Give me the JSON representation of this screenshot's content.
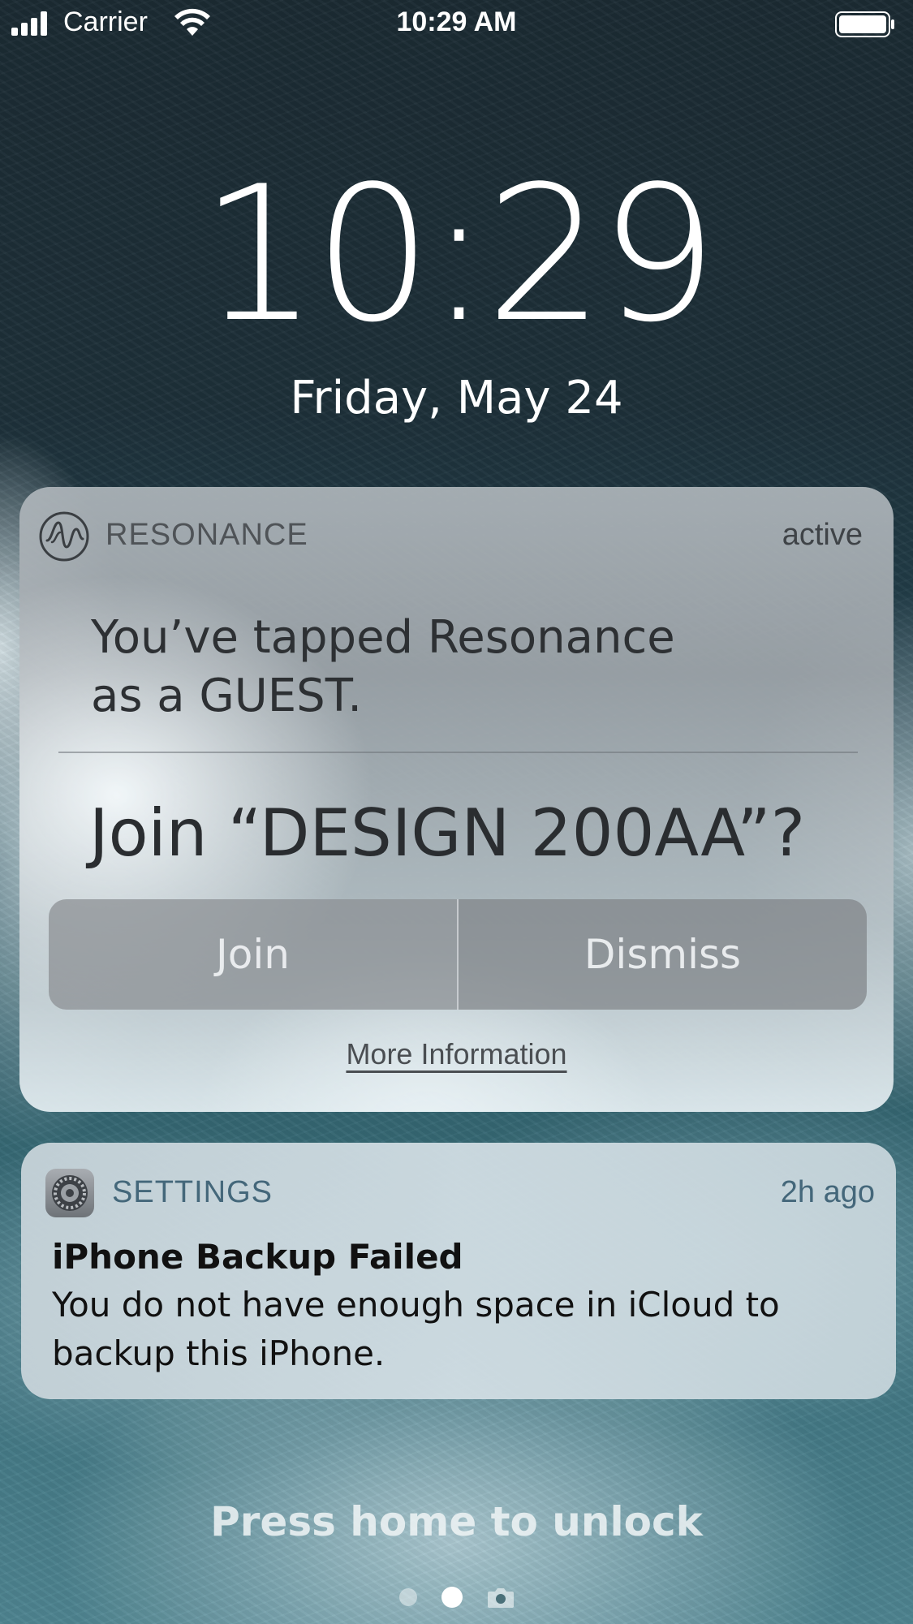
{
  "status_bar": {
    "carrier": "Carrier",
    "time": "10:29 AM"
  },
  "lock_screen": {
    "clock": "10:29",
    "date": "Friday, May 24",
    "unlock_hint": "Press home to unlock",
    "page_dots": {
      "count": 2,
      "active_index": 1
    }
  },
  "notifications": {
    "resonance": {
      "app_name": "RESONANCE",
      "status": "active",
      "message": "You’ve tapped Resonance as a GUEST.",
      "prompt": "Join “DESIGN 200AA”?",
      "join_label": "Join",
      "dismiss_label": "Dismiss",
      "more_info_label": "More Information",
      "icon": "resonance-logo-icon"
    },
    "settings": {
      "app_name": "SETTINGS",
      "time": "2h ago",
      "title": "iPhone Backup Failed",
      "body": "You do not have enough space in iCloud to backup this iPhone.",
      "icon": "settings-gear-icon"
    }
  },
  "colors": {
    "settings_accent": "#44677a",
    "button_text": "#f0f2f4"
  }
}
